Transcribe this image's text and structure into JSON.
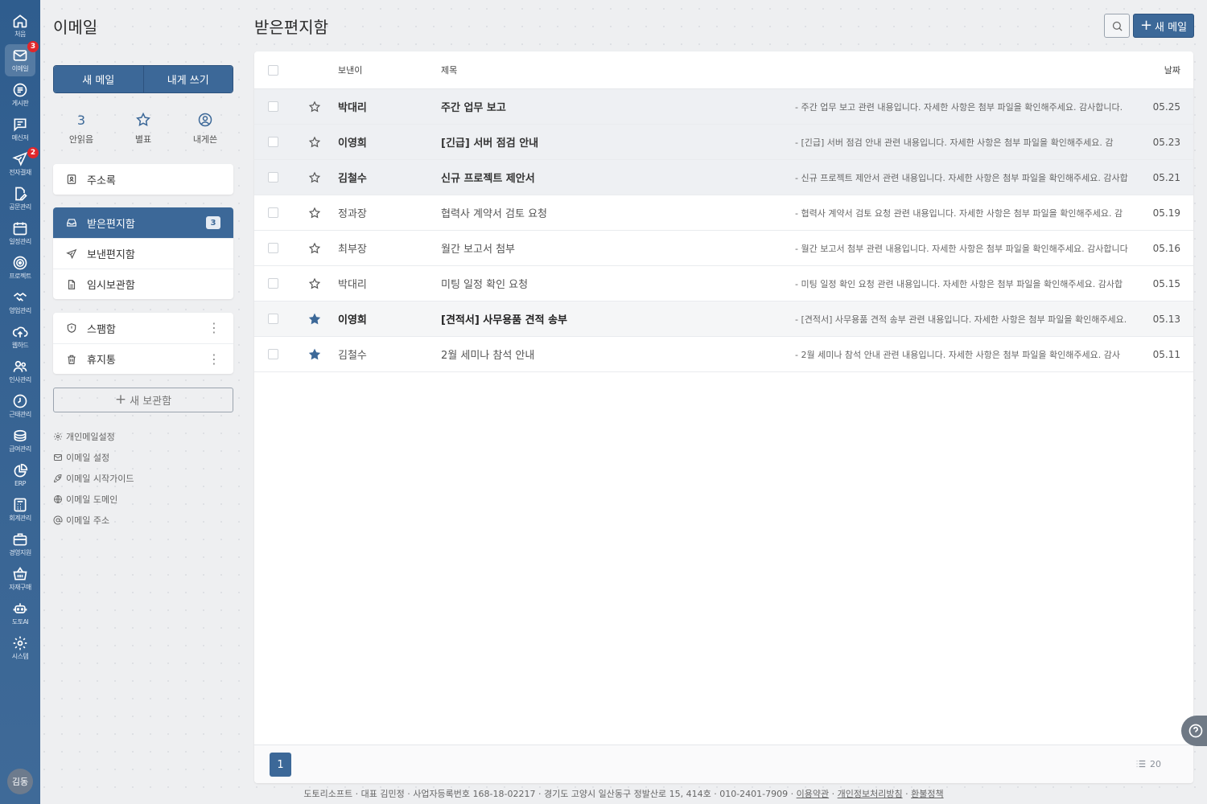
{
  "rail": {
    "items": [
      {
        "label": "처음",
        "icon": "home-icon"
      },
      {
        "label": "이메일",
        "icon": "mail-icon",
        "badge": "3"
      },
      {
        "label": "게시판",
        "icon": "board-icon"
      },
      {
        "label": "메신저",
        "icon": "messenger-icon"
      },
      {
        "label": "전자결재",
        "icon": "approval-icon",
        "badge": "2"
      },
      {
        "label": "공문관리",
        "icon": "document-edit-icon"
      },
      {
        "label": "일정관리",
        "icon": "calendar-icon"
      },
      {
        "label": "프로젝트",
        "icon": "target-icon"
      },
      {
        "label": "영업관리",
        "icon": "handshake-icon"
      },
      {
        "label": "웹하드",
        "icon": "cloud-upload-icon"
      },
      {
        "label": "인사관리",
        "icon": "people-icon"
      },
      {
        "label": "근태관리",
        "icon": "clock-icon"
      },
      {
        "label": "급여관리",
        "icon": "coins-icon"
      },
      {
        "label": "ERP",
        "icon": "pie-chart-icon"
      },
      {
        "label": "회계관리",
        "icon": "calculator-icon"
      },
      {
        "label": "경영지원",
        "icon": "briefcase-icon"
      },
      {
        "label": "자재구매",
        "icon": "basket-icon"
      },
      {
        "label": "도토AI",
        "icon": "robot-icon"
      },
      {
        "label": "시스템",
        "icon": "gear-icon"
      }
    ],
    "avatar": "김동"
  },
  "sidebar": {
    "title": "이메일",
    "compose_label": "새 메일",
    "self_label": "내게 쓰기",
    "quick": {
      "unread_count": "3",
      "unread_label": "안읽음",
      "starred_label": "별표",
      "self_label": "내게쓴"
    },
    "address_book": "주소록",
    "folders": [
      {
        "label": "받은편지함",
        "count": "3"
      },
      {
        "label": "보낸편지함"
      },
      {
        "label": "임시보관함"
      }
    ],
    "extra_folders": [
      {
        "label": "스팸함"
      },
      {
        "label": "휴지통"
      }
    ],
    "new_folder_label": "새 보관함",
    "settings": [
      {
        "label": "개인메일설정"
      },
      {
        "label": "이메일 설정"
      },
      {
        "label": "이메일 시작가이드"
      },
      {
        "label": "이메일 도메인"
      },
      {
        "label": "이메일 주소"
      }
    ]
  },
  "main": {
    "title": "받은편지함",
    "new_mail_label": "새 메일",
    "columns": {
      "sender": "보낸이",
      "subject": "제목",
      "date": "날짜"
    },
    "emails": [
      {
        "sender": "박대리",
        "subject": "주간 업무 보고",
        "preview": "- 주간 업무 보고 관련 내용입니다. 자세한 사항은 첨부 파일을 확인해주세요. 감사합니다.",
        "date": "05.25"
      },
      {
        "sender": "이영희",
        "subject": "[긴급] 서버 점검 안내",
        "preview": "- [긴급] 서버 점검 안내 관련 내용입니다. 자세한 사항은 첨부 파일을 확인해주세요. 감",
        "date": "05.23"
      },
      {
        "sender": "김철수",
        "subject": "신규 프로젝트 제안서",
        "preview": "- 신규 프로젝트 제안서 관련 내용입니다. 자세한 사항은 첨부 파일을 확인해주세요. 감사합",
        "date": "05.21"
      },
      {
        "sender": "정과장",
        "subject": "협력사 계약서 검토 요청",
        "preview": "- 협력사 계약서 검토 요청 관련 내용입니다. 자세한 사항은 첨부 파일을 확인해주세요. 감",
        "date": "05.19"
      },
      {
        "sender": "최부장",
        "subject": "월간 보고서 첨부",
        "preview": "- 월간 보고서 첨부 관련 내용입니다. 자세한 사항은 첨부 파일을 확인해주세요. 감사합니다",
        "date": "05.16"
      },
      {
        "sender": "박대리",
        "subject": "미팅 일정 확인 요청",
        "preview": "- 미팅 일정 확인 요청 관련 내용입니다. 자세한 사항은 첨부 파일을 확인해주세요. 감사합",
        "date": "05.15"
      },
      {
        "sender": "이영희",
        "subject": "[견적서] 사무용품 견적 송부",
        "preview": "- [견적서] 사무용품 견적 송부 관련 내용입니다. 자세한 사항은 첨부 파일을 확인해주세요.",
        "date": "05.13"
      },
      {
        "sender": "김철수",
        "subject": "2월 세미나 참석 안내",
        "preview": "- 2월 세미나 참석 안내 관련 내용입니다. 자세한 사항은 첨부 파일을 확인해주세요. 감사",
        "date": "05.11"
      }
    ],
    "page": "1",
    "per_page": "20"
  },
  "footer": {
    "text": "도토리소프트 · 대표 김민정 · 사업자등록번호 168-18-02217 · 경기도 고양시 일산동구 정발산로 15, 414호 · 010-2401-7909 ·",
    "terms": "이용약관",
    "privacy": "개인정보처리방침",
    "refund": "환불정책"
  },
  "colors": {
    "primary": "#3c6898",
    "rail": "#2f5d8e",
    "badge": "#e0272b"
  }
}
